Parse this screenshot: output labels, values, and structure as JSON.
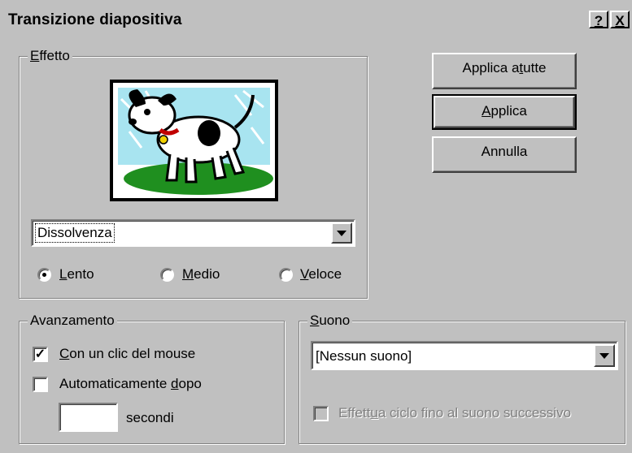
{
  "window": {
    "title": "Transizione diapositiva",
    "help_glyph": "?",
    "close_glyph": "X"
  },
  "effect_group": {
    "legend_first": "E",
    "legend_rest": "ffetto",
    "preview_image": "dog-cartoon",
    "effect_select_value": "Dissolvenza",
    "speed": {
      "selected": "Lento",
      "options": [
        {
          "mnemonic": "L",
          "rest": "ento"
        },
        {
          "mnemonic": "M",
          "rest": "edio"
        },
        {
          "mnemonic": "V",
          "rest": "eloce"
        }
      ]
    }
  },
  "buttons": {
    "apply_all_pre": "Applica a ",
    "apply_all_mn": "t",
    "apply_all_post": "utte",
    "apply_mn": "A",
    "apply_post": "pplica",
    "cancel": "Annulla"
  },
  "advance_group": {
    "legend": "Avanzamento",
    "on_click_mn": "C",
    "on_click_rest": "on un clic del mouse",
    "on_click_checked": true,
    "auto_pre": "Automaticamente ",
    "auto_mn": "d",
    "auto_post": "opo",
    "auto_checked": false,
    "seconds_value": "",
    "seconds_label": "secondi"
  },
  "sound_group": {
    "legend_mn": "S",
    "legend_rest": "uono",
    "sound_select_value": "[Nessun suono]",
    "loop_pre": "Effett",
    "loop_mn": "u",
    "loop_post": "a ciclo fino al suono successivo",
    "loop_checked": false
  }
}
